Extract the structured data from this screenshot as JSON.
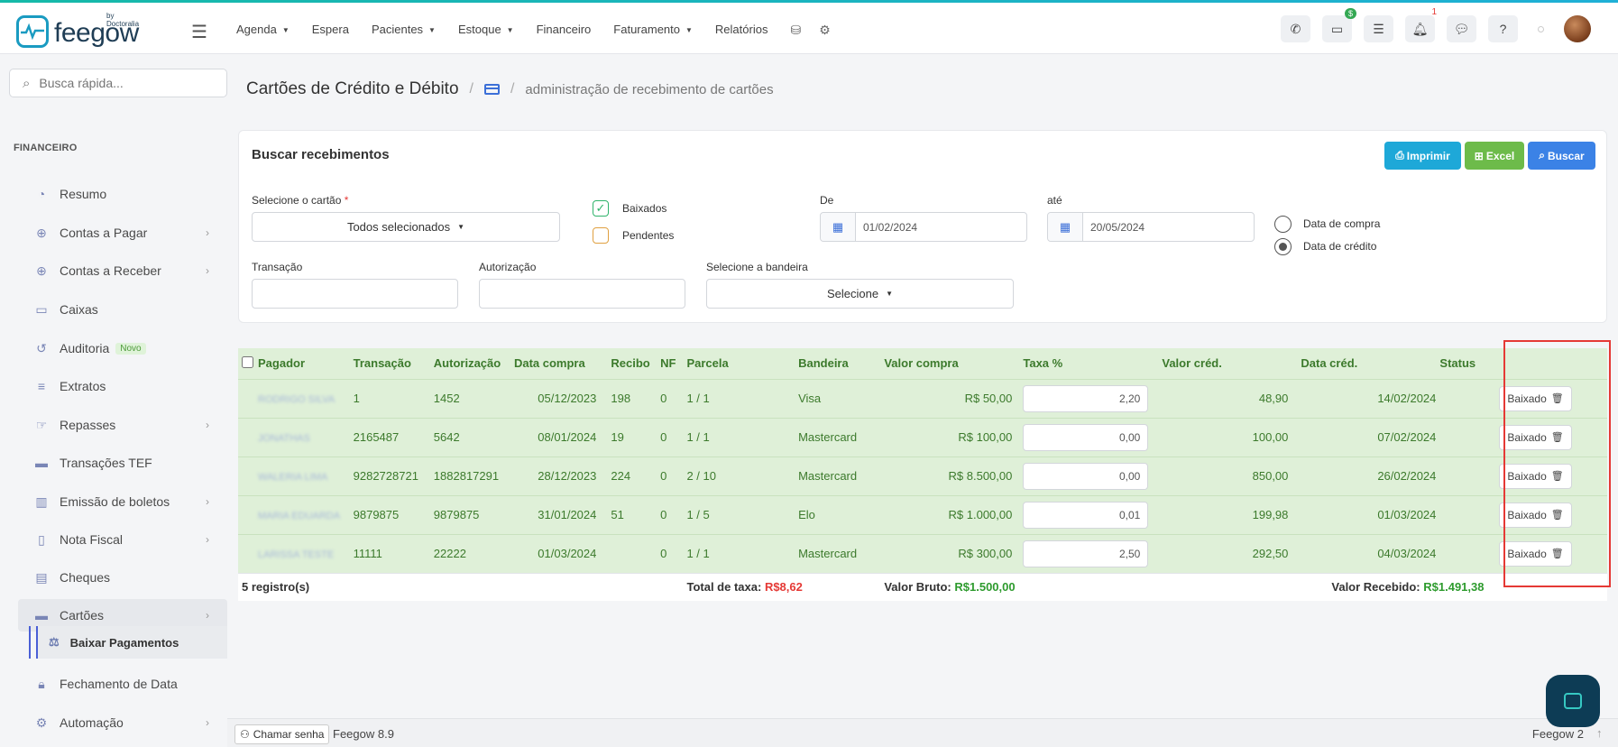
{
  "brand": {
    "name": "feegow",
    "sub": "by Doctoralia"
  },
  "topnav": [
    {
      "label": "Agenda",
      "caret": true
    },
    {
      "label": "Espera",
      "caret": false
    },
    {
      "label": "Pacientes",
      "caret": true
    },
    {
      "label": "Estoque",
      "caret": true
    },
    {
      "label": "Financeiro",
      "caret": false
    },
    {
      "label": "Faturamento",
      "caret": true
    },
    {
      "label": "Relatórios",
      "caret": false
    }
  ],
  "topright": {
    "money_badge": "$",
    "notif_badge": "1"
  },
  "search": {
    "placeholder": "Busca rápida..."
  },
  "sidebar": {
    "section": "FINANCEIRO",
    "items": [
      {
        "label": "Resumo",
        "icon": "chart-pie-icon",
        "chev": false
      },
      {
        "label": "Contas a Pagar",
        "icon": "arrow-up-circle-icon",
        "chev": true
      },
      {
        "label": "Contas a Receber",
        "icon": "arrow-down-circle-icon",
        "chev": true
      },
      {
        "label": "Caixas",
        "icon": "inbox-icon",
        "chev": false
      },
      {
        "label": "Auditoria",
        "icon": "history-icon",
        "chev": false,
        "badge": "Novo"
      },
      {
        "label": "Extratos",
        "icon": "list-icon",
        "chev": false
      },
      {
        "label": "Repasses",
        "icon": "hand-icon",
        "chev": true
      },
      {
        "label": "Transações TEF",
        "icon": "card-icon",
        "chev": false
      },
      {
        "label": "Emissão de boletos",
        "icon": "barcode-icon",
        "chev": true
      },
      {
        "label": "Nota Fiscal",
        "icon": "file-icon",
        "chev": true
      },
      {
        "label": "Cheques",
        "icon": "cheque-icon",
        "chev": false
      },
      {
        "label": "Cartões",
        "icon": "card-icon",
        "chev": true
      },
      {
        "label": "Fechamento de Data",
        "icon": "lock-icon",
        "chev": false
      },
      {
        "label": "Automação",
        "icon": "gears-icon",
        "chev": true
      }
    ],
    "sub_item": "Baixar Pagamentos"
  },
  "header": {
    "title": "Cartões de Crédito e Débito",
    "subtitle": "administração de recebimento de cartões"
  },
  "filters": {
    "title": "Buscar recebimentos",
    "print": "Imprimir",
    "excel": "Excel",
    "search": "Buscar",
    "card_label": "Selecione o cartão",
    "card_value": "Todos selecionados",
    "baixados": "Baixados",
    "pendentes": "Pendentes",
    "de_label": "De",
    "de_value": "01/02/2024",
    "ate_label": "até",
    "ate_value": "20/05/2024",
    "radio_compra": "Data de compra",
    "radio_credito": "Data de crédito",
    "transacao_label": "Transação",
    "autorizacao_label": "Autorização",
    "bandeira_label": "Selecione a bandeira",
    "bandeira_value": "Selecione"
  },
  "table": {
    "headers": [
      "Pagador",
      "Transação",
      "Autorização",
      "Data compra",
      "Recibo",
      "NF",
      "Parcela",
      "Bandeira",
      "Valor compra",
      "Taxa %",
      "Valor créd.",
      "Data créd.",
      "Status"
    ],
    "rows": [
      {
        "pagador": "RODRIGO SILVA",
        "transacao": "1",
        "autorizacao": "1452",
        "data_compra": "05/12/2023",
        "recibo": "198",
        "nf": "0",
        "parcela": "1 / 1",
        "bandeira": "Visa",
        "valor_compra": "R$ 50,00",
        "taxa": "2,20",
        "valor_cred": "48,90",
        "data_cred": "14/02/2024",
        "status": "Baixado"
      },
      {
        "pagador": "JONATHAS",
        "transacao": "2165487",
        "autorizacao": "5642",
        "data_compra": "08/01/2024",
        "recibo": "19",
        "nf": "0",
        "parcela": "1 / 1",
        "bandeira": "Mastercard",
        "valor_compra": "R$ 100,00",
        "taxa": "0,00",
        "valor_cred": "100,00",
        "data_cred": "07/02/2024",
        "status": "Baixado"
      },
      {
        "pagador": "WALERIA LIMA",
        "transacao": "9282728721",
        "autorizacao": "1882817291",
        "data_compra": "28/12/2023",
        "recibo": "224",
        "nf": "0",
        "parcela": "2 / 10",
        "bandeira": "Mastercard",
        "valor_compra": "R$ 8.500,00",
        "taxa": "0,00",
        "valor_cred": "850,00",
        "data_cred": "26/02/2024",
        "status": "Baixado"
      },
      {
        "pagador": "MARIA EDUARDA",
        "transacao": "9879875",
        "autorizacao": "9879875",
        "data_compra": "31/01/2024",
        "recibo": "51",
        "nf": "0",
        "parcela": "1 / 5",
        "bandeira": "Elo",
        "valor_compra": "R$ 1.000,00",
        "taxa": "0,01",
        "valor_cred": "199,98",
        "data_cred": "01/03/2024",
        "status": "Baixado"
      },
      {
        "pagador": "LARISSA TESTE",
        "transacao": "11111",
        "autorizacao": "22222",
        "data_compra": "01/03/2024",
        "recibo": "",
        "nf": "0",
        "parcela": "1 / 1",
        "bandeira": "Mastercard",
        "valor_compra": "R$ 300,00",
        "taxa": "2,50",
        "valor_cred": "292,50",
        "data_cred": "04/03/2024",
        "status": "Baixado"
      }
    ],
    "footer": {
      "count": "5 registro(s)",
      "total_taxa_label": "Total de taxa:",
      "total_taxa": "R$8,62",
      "valor_bruto_label": "Valor Bruto:",
      "valor_bruto": "R$1.500,00",
      "valor_recebido_label": "Valor Recebido:",
      "valor_recebido": "R$1.491,38"
    }
  },
  "bottom": {
    "call_label": "Chamar senha",
    "version": "Feegow 8.9",
    "version_right": "Feegow 2"
  }
}
